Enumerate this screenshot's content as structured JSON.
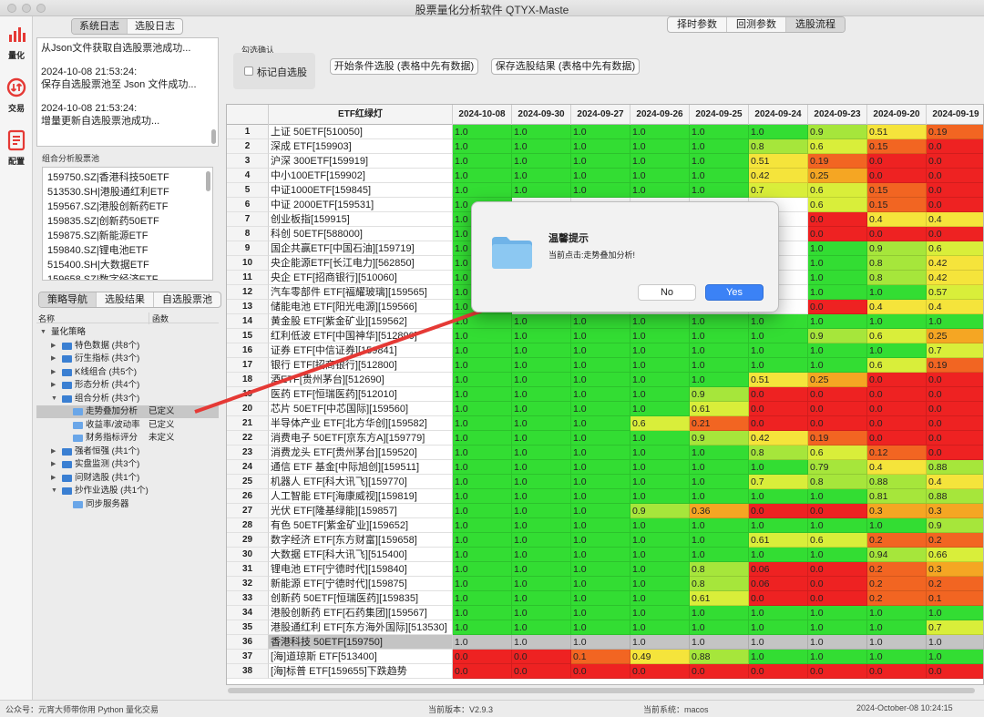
{
  "window": {
    "title": "股票量化分析软件 QTYX-Maste"
  },
  "leftbar": [
    {
      "label": "量化",
      "icon": "bar-chart-icon"
    },
    {
      "label": "交易",
      "icon": "refresh-icon"
    },
    {
      "label": "配置",
      "icon": "document-icon"
    }
  ],
  "log_tabs": [
    "系统日志",
    "选股日志"
  ],
  "log_entries": [
    "从Json文件获取自选股票池成功...",
    "2024-10-08 21:53:24:\n保存自选股票池至 Json 文件成功...",
    "2024-10-08 21:53:24:\n增量更新自选股票池成功..."
  ],
  "combo": {
    "label": "组合分析股票池",
    "items": [
      "159750.SZ|香港科技50ETF",
      "513530.SH|港股通红利ETF",
      "159567.SZ|港股创新药ETF",
      "159835.SZ|创新药50ETF",
      "159875.SZ|新能源ETF",
      "159840.SZ|锂电池ETF",
      "515400.SH|大数据ETF",
      "159658.SZ|数字经济ETF"
    ]
  },
  "nav_tabs": [
    "策略导航",
    "选股结果",
    "自选股票池"
  ],
  "tree": {
    "headers": {
      "name": "名称",
      "func": "函数"
    },
    "nodes": [
      {
        "label": "量化策略",
        "func": "",
        "level": 0,
        "expanded": true,
        "folder": false,
        "selected": false
      },
      {
        "label": "特色数据 (共8个)",
        "func": "",
        "level": 1,
        "expanded": false,
        "folder": true,
        "selected": false
      },
      {
        "label": "衍生指标 (共3个)",
        "func": "",
        "level": 1,
        "expanded": false,
        "folder": true,
        "selected": false
      },
      {
        "label": "K线组合 (共5个)",
        "func": "",
        "level": 1,
        "expanded": false,
        "folder": true,
        "selected": false
      },
      {
        "label": "形态分析 (共4个)",
        "func": "",
        "level": 1,
        "expanded": false,
        "folder": true,
        "selected": false
      },
      {
        "label": "组合分析 (共3个)",
        "func": "",
        "level": 1,
        "expanded": true,
        "folder": true,
        "selected": false
      },
      {
        "label": "走势叠加分析",
        "func": "已定义",
        "level": 2,
        "expanded": null,
        "folder": true,
        "selected": true
      },
      {
        "label": "收益率/波动率",
        "func": "已定义",
        "level": 2,
        "expanded": null,
        "folder": true,
        "selected": false
      },
      {
        "label": "财务指标评分",
        "func": "未定义",
        "level": 2,
        "expanded": null,
        "folder": true,
        "selected": false
      },
      {
        "label": "强者恒强 (共1个)",
        "func": "",
        "level": 1,
        "expanded": false,
        "folder": true,
        "selected": false
      },
      {
        "label": "实盘监测 (共3个)",
        "func": "",
        "level": 1,
        "expanded": false,
        "folder": true,
        "selected": false
      },
      {
        "label": "问财选股 (共1个)",
        "func": "",
        "level": 1,
        "expanded": false,
        "folder": true,
        "selected": false
      },
      {
        "label": "抄作业选股 (共1个)",
        "func": "",
        "level": 1,
        "expanded": true,
        "folder": true,
        "selected": false
      },
      {
        "label": "同步服务器",
        "func": "",
        "level": 2,
        "expanded": null,
        "folder": true,
        "selected": false
      }
    ]
  },
  "top_tabs": [
    "择时参数",
    "回测参数",
    "选股流程"
  ],
  "filter": {
    "title": "勾选确认",
    "checkbox_label": "标记自选股",
    "checked": false
  },
  "buttons": {
    "start": "开始条件选股 (表格中先有数据)",
    "save": "保存选股结果 (表格中先有数据)"
  },
  "table": {
    "name_header": "ETF红绿灯",
    "date_headers": [
      "2024-10-08",
      "2024-09-30",
      "2024-09-27",
      "2024-09-26",
      "2024-09-25",
      "2024-09-24",
      "2024-09-23",
      "2024-09-20",
      "2024-09-19"
    ],
    "highlight_row": 36,
    "rows": [
      {
        "no": "1",
        "name": "上证 50ETF[510050]",
        "vals": [
          "1.0",
          "1.0",
          "1.0",
          "1.0",
          "1.0",
          "1.0",
          "0.9",
          "0.51",
          "0.19"
        ]
      },
      {
        "no": "2",
        "name": "深成 ETF[159903]",
        "vals": [
          "1.0",
          "1.0",
          "1.0",
          "1.0",
          "1.0",
          "0.8",
          "0.6",
          "0.15",
          "0.0"
        ]
      },
      {
        "no": "3",
        "name": "沪深 300ETF[159919]",
        "vals": [
          "1.0",
          "1.0",
          "1.0",
          "1.0",
          "1.0",
          "0.51",
          "0.19",
          "0.0",
          "0.0"
        ]
      },
      {
        "no": "4",
        "name": "中小100ETF[159902]",
        "vals": [
          "1.0",
          "1.0",
          "1.0",
          "1.0",
          "1.0",
          "0.42",
          "0.25",
          "0.0",
          "0.0"
        ]
      },
      {
        "no": "5",
        "name": "中证1000ETF[159845]",
        "vals": [
          "1.0",
          "1.0",
          "1.0",
          "1.0",
          "1.0",
          "0.7",
          "0.6",
          "0.15",
          "0.0"
        ]
      },
      {
        "no": "6",
        "name": "中证 2000ETF[159531]",
        "vals": [
          "1.0",
          "",
          "",
          "",
          "",
          "",
          "0.6",
          "0.15",
          "0.0"
        ]
      },
      {
        "no": "7",
        "name": "创业板指[159915]",
        "vals": [
          "1.0",
          "",
          "",
          "",
          "",
          "",
          "0.0",
          "0.4",
          "0.4"
        ]
      },
      {
        "no": "8",
        "name": "科创 50ETF[588000]",
        "vals": [
          "1.0",
          "",
          "",
          "",
          "",
          "",
          "0.0",
          "0.0",
          "0.0"
        ]
      },
      {
        "no": "9",
        "name": "国企共赢ETF[中国石油][159719]",
        "vals": [
          "1.0",
          "",
          "",
          "",
          "",
          "",
          "1.0",
          "0.9",
          "0.6"
        ]
      },
      {
        "no": "10",
        "name": "央企能源ETF[长江电力][562850]",
        "vals": [
          "1.0",
          "",
          "",
          "",
          "",
          "",
          "1.0",
          "0.8",
          "0.42"
        ]
      },
      {
        "no": "11",
        "name": "央企 ETF[招商银行][510060]",
        "vals": [
          "1.0",
          "",
          "",
          "",
          "",
          "",
          "1.0",
          "0.8",
          "0.42"
        ]
      },
      {
        "no": "12",
        "name": "汽车零部件 ETF[福耀玻璃][159565]",
        "vals": [
          "1.0",
          "",
          "",
          "",
          "",
          "",
          "1.0",
          "1.0",
          "0.57"
        ]
      },
      {
        "no": "13",
        "name": "储能电池 ETF[阳光电源][159566]",
        "vals": [
          "1.0",
          "",
          "",
          "",
          "",
          "",
          "0.0",
          "0.4",
          "0.4"
        ]
      },
      {
        "no": "14",
        "name": "黄金股 ETF[紫金矿业][159562]",
        "vals": [
          "1.0",
          "1.0",
          "1.0",
          "1.0",
          "1.0",
          "1.0",
          "1.0",
          "1.0",
          "1.0"
        ]
      },
      {
        "no": "15",
        "name": "红利低波 ETF[中国神华][512890]",
        "vals": [
          "1.0",
          "1.0",
          "1.0",
          "1.0",
          "1.0",
          "1.0",
          "0.9",
          "0.6",
          "0.25"
        ]
      },
      {
        "no": "16",
        "name": "证券 ETF[中信证券][159841]",
        "vals": [
          "1.0",
          "1.0",
          "1.0",
          "1.0",
          "1.0",
          "1.0",
          "1.0",
          "1.0",
          "0.7"
        ]
      },
      {
        "no": "17",
        "name": "银行 ETF[招商银行][512800]",
        "vals": [
          "1.0",
          "1.0",
          "1.0",
          "1.0",
          "1.0",
          "1.0",
          "1.0",
          "0.6",
          "0.19"
        ]
      },
      {
        "no": "18",
        "name": "酒ETF[贵州茅台][512690]",
        "vals": [
          "1.0",
          "1.0",
          "1.0",
          "1.0",
          "1.0",
          "0.51",
          "0.25",
          "0.0",
          "0.0"
        ]
      },
      {
        "no": "19",
        "name": "医药 ETF[恒瑞医药][512010]",
        "vals": [
          "1.0",
          "1.0",
          "1.0",
          "1.0",
          "0.9",
          "0.0",
          "0.0",
          "0.0",
          "0.0"
        ]
      },
      {
        "no": "20",
        "name": "芯片 50ETF[中芯国际][159560]",
        "vals": [
          "1.0",
          "1.0",
          "1.0",
          "1.0",
          "0.61",
          "0.0",
          "0.0",
          "0.0",
          "0.0"
        ]
      },
      {
        "no": "21",
        "name": "半导体产业 ETF[北方华创][159582]",
        "vals": [
          "1.0",
          "1.0",
          "1.0",
          "0.6",
          "0.21",
          "0.0",
          "0.0",
          "0.0",
          "0.0"
        ]
      },
      {
        "no": "22",
        "name": "消费电子 50ETF[京东方A][159779]",
        "vals": [
          "1.0",
          "1.0",
          "1.0",
          "1.0",
          "0.9",
          "0.42",
          "0.19",
          "0.0",
          "0.0"
        ]
      },
      {
        "no": "23",
        "name": "消费龙头 ETF[贵州茅台][159520]",
        "vals": [
          "1.0",
          "1.0",
          "1.0",
          "1.0",
          "1.0",
          "0.8",
          "0.6",
          "0.12",
          "0.0"
        ]
      },
      {
        "no": "24",
        "name": "通信 ETF 基金[中际旭创][159511]",
        "vals": [
          "1.0",
          "1.0",
          "1.0",
          "1.0",
          "1.0",
          "1.0",
          "0.79",
          "0.4",
          "0.88"
        ]
      },
      {
        "no": "25",
        "name": "机器人 ETF[科大讯飞][159770]",
        "vals": [
          "1.0",
          "1.0",
          "1.0",
          "1.0",
          "1.0",
          "0.7",
          "0.8",
          "0.88",
          "0.4"
        ]
      },
      {
        "no": "26",
        "name": "人工智能 ETF[海康威视][159819]",
        "vals": [
          "1.0",
          "1.0",
          "1.0",
          "1.0",
          "1.0",
          "1.0",
          "1.0",
          "0.81",
          "0.88"
        ]
      },
      {
        "no": "27",
        "name": "光伏 ETF[隆基绿能][159857]",
        "vals": [
          "1.0",
          "1.0",
          "1.0",
          "0.9",
          "0.36",
          "0.0",
          "0.0",
          "0.3",
          "0.3"
        ]
      },
      {
        "no": "28",
        "name": "有色 50ETF[紫金矿业][159652]",
        "vals": [
          "1.0",
          "1.0",
          "1.0",
          "1.0",
          "1.0",
          "1.0",
          "1.0",
          "1.0",
          "0.9"
        ]
      },
      {
        "no": "29",
        "name": "数字经济 ETF[东方财富][159658]",
        "vals": [
          "1.0",
          "1.0",
          "1.0",
          "1.0",
          "1.0",
          "0.61",
          "0.6",
          "0.2",
          "0.2"
        ]
      },
      {
        "no": "30",
        "name": "大数据 ETF[科大讯飞][515400]",
        "vals": [
          "1.0",
          "1.0",
          "1.0",
          "1.0",
          "1.0",
          "1.0",
          "1.0",
          "0.94",
          "0.66"
        ]
      },
      {
        "no": "31",
        "name": "锂电池 ETF[宁德时代][159840]",
        "vals": [
          "1.0",
          "1.0",
          "1.0",
          "1.0",
          "0.8",
          "0.06",
          "0.0",
          "0.2",
          "0.3"
        ]
      },
      {
        "no": "32",
        "name": "新能源 ETF[宁德时代][159875]",
        "vals": [
          "1.0",
          "1.0",
          "1.0",
          "1.0",
          "0.8",
          "0.06",
          "0.0",
          "0.2",
          "0.2"
        ]
      },
      {
        "no": "33",
        "name": "创新药 50ETF[恒瑞医药][159835]",
        "vals": [
          "1.0",
          "1.0",
          "1.0",
          "1.0",
          "0.61",
          "0.0",
          "0.0",
          "0.2",
          "0.1"
        ]
      },
      {
        "no": "34",
        "name": "港股创新药 ETF[石药集团][159567]",
        "vals": [
          "1.0",
          "1.0",
          "1.0",
          "1.0",
          "1.0",
          "1.0",
          "1.0",
          "1.0",
          "1.0"
        ]
      },
      {
        "no": "35",
        "name": "港股通红利 ETF[东方海外国际][513530]",
        "vals": [
          "1.0",
          "1.0",
          "1.0",
          "1.0",
          "1.0",
          "1.0",
          "1.0",
          "1.0",
          "0.7"
        ]
      },
      {
        "no": "36",
        "name": "香港科技 50ETF[159750]",
        "vals": [
          "1.0",
          "1.0",
          "1.0",
          "1.0",
          "1.0",
          "1.0",
          "1.0",
          "1.0",
          "1.0"
        ]
      },
      {
        "no": "37",
        "name": "[海]道琼斯 ETF[513400]",
        "vals": [
          "0.0",
          "0.0",
          "0.1",
          "0.49",
          "0.88",
          "1.0",
          "1.0",
          "1.0",
          "1.0"
        ]
      },
      {
        "no": "38",
        "name": "[海]标普 ETF[159655]下跌趋势",
        "vals": [
          "0.0",
          "0.0",
          "0.0",
          "0.0",
          "0.0",
          "0.0",
          "0.0",
          "0.0",
          "0.0"
        ]
      }
    ]
  },
  "dialog": {
    "title": "温馨提示",
    "message": "当前点击:走势叠加分析!",
    "no_label": "No",
    "yes_label": "Yes"
  },
  "status": {
    "left": "公众号：元宵大师带你用 Python 量化交易",
    "version": "当前版本：V2.9.3",
    "system": "当前系统：macos",
    "time": "2024-October-08 10:24:15"
  },
  "colors": {
    "accent_blue": "#3b82f6",
    "icon_red": "#e53935",
    "arrow_red": "#e53935"
  }
}
